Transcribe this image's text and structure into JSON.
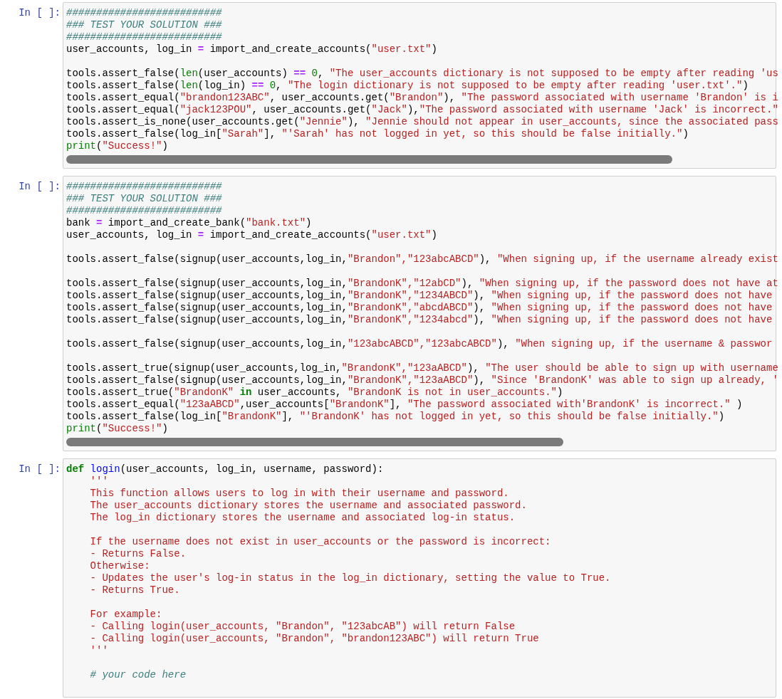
{
  "cells": [
    {
      "prompt": "In [ ]:",
      "lines": [
        {
          "kind": "code",
          "tokens": [
            {
              "kind": "comment",
              "text": "##########################"
            }
          ]
        },
        {
          "kind": "code",
          "tokens": [
            {
              "kind": "comment",
              "text": "### TEST YOUR SOLUTION ###"
            }
          ]
        },
        {
          "kind": "code",
          "tokens": [
            {
              "kind": "comment",
              "text": "##########################"
            }
          ]
        },
        {
          "kind": "code",
          "tokens": [
            {
              "kind": "plain",
              "text": "user_accounts, log_in "
            },
            {
              "kind": "op",
              "text": "="
            },
            {
              "kind": "plain",
              "text": " import_and_create_accounts("
            },
            {
              "kind": "str",
              "text": "\"user.txt\""
            },
            {
              "kind": "plain",
              "text": ")"
            }
          ]
        },
        {
          "kind": "blank"
        },
        {
          "kind": "code",
          "tokens": [
            {
              "kind": "plain",
              "text": "tools.assert_false("
            },
            {
              "kind": "builtin",
              "text": "len"
            },
            {
              "kind": "plain",
              "text": "(user_accounts) "
            },
            {
              "kind": "op",
              "text": "=="
            },
            {
              "kind": "num",
              "text": " 0"
            },
            {
              "kind": "plain",
              "text": ", "
            },
            {
              "kind": "str",
              "text": "\"The user_accounts dictionary is not supposed to be empty after reading 'us"
            }
          ]
        },
        {
          "kind": "code",
          "tokens": [
            {
              "kind": "plain",
              "text": "tools.assert_false("
            },
            {
              "kind": "builtin",
              "text": "len"
            },
            {
              "kind": "plain",
              "text": "(log_in) "
            },
            {
              "kind": "op",
              "text": "=="
            },
            {
              "kind": "num",
              "text": " 0"
            },
            {
              "kind": "plain",
              "text": ", "
            },
            {
              "kind": "str",
              "text": "\"The login dictionary is not supposed to be empty after reading 'user.txt'.\""
            },
            {
              "kind": "plain",
              "text": ")"
            }
          ]
        },
        {
          "kind": "code",
          "tokens": [
            {
              "kind": "plain",
              "text": "tools.assert_equal("
            },
            {
              "kind": "str",
              "text": "\"brandon123ABC\""
            },
            {
              "kind": "plain",
              "text": ", user_accounts.get("
            },
            {
              "kind": "str",
              "text": "\"Brandon\""
            },
            {
              "kind": "plain",
              "text": "), "
            },
            {
              "kind": "str",
              "text": "\"The password associated with username 'Brandon' is i"
            }
          ]
        },
        {
          "kind": "code",
          "tokens": [
            {
              "kind": "plain",
              "text": "tools.assert_equal("
            },
            {
              "kind": "str",
              "text": "\"jack123POU\""
            },
            {
              "kind": "plain",
              "text": ", user_accounts.get("
            },
            {
              "kind": "str",
              "text": "\"Jack\""
            },
            {
              "kind": "plain",
              "text": "),"
            },
            {
              "kind": "str",
              "text": "\"The password associated with username 'Jack' is incorrect.\""
            }
          ]
        },
        {
          "kind": "code",
          "tokens": [
            {
              "kind": "plain",
              "text": "tools.assert_is_none(user_accounts.get("
            },
            {
              "kind": "str",
              "text": "\"Jennie\""
            },
            {
              "kind": "plain",
              "text": "), "
            },
            {
              "kind": "str",
              "text": "\"Jennie should not appear in user_accounts, since the associated pass"
            }
          ]
        },
        {
          "kind": "code",
          "tokens": [
            {
              "kind": "plain",
              "text": "tools.assert_false(log_in["
            },
            {
              "kind": "str",
              "text": "\"Sarah\""
            },
            {
              "kind": "plain",
              "text": "], "
            },
            {
              "kind": "str",
              "text": "\"'Sarah' has not logged in yet, so this should be false initially.\""
            },
            {
              "kind": "plain",
              "text": ")"
            }
          ]
        },
        {
          "kind": "code",
          "tokens": [
            {
              "kind": "builtin",
              "text": "print"
            },
            {
              "kind": "plain",
              "text": "("
            },
            {
              "kind": "str",
              "text": "\"Success!\""
            },
            {
              "kind": "plain",
              "text": ")"
            }
          ]
        }
      ]
    },
    {
      "prompt": "In [ ]:",
      "lines": [
        {
          "kind": "code",
          "tokens": [
            {
              "kind": "comment",
              "text": "##########################"
            }
          ]
        },
        {
          "kind": "code",
          "tokens": [
            {
              "kind": "comment",
              "text": "### TEST YOUR SOLUTION ###"
            }
          ]
        },
        {
          "kind": "code",
          "tokens": [
            {
              "kind": "comment",
              "text": "##########################"
            }
          ]
        },
        {
          "kind": "code",
          "tokens": [
            {
              "kind": "plain",
              "text": "bank "
            },
            {
              "kind": "op",
              "text": "="
            },
            {
              "kind": "plain",
              "text": " import_and_create_bank("
            },
            {
              "kind": "str",
              "text": "\"bank.txt\""
            },
            {
              "kind": "plain",
              "text": ")"
            }
          ]
        },
        {
          "kind": "code",
          "tokens": [
            {
              "kind": "plain",
              "text": "user_accounts, log_in "
            },
            {
              "kind": "op",
              "text": "="
            },
            {
              "kind": "plain",
              "text": " import_and_create_accounts("
            },
            {
              "kind": "str",
              "text": "\"user.txt\""
            },
            {
              "kind": "plain",
              "text": ")"
            }
          ]
        },
        {
          "kind": "blank"
        },
        {
          "kind": "code",
          "tokens": [
            {
              "kind": "plain",
              "text": "tools.assert_false(signup(user_accounts,log_in,"
            },
            {
              "kind": "str",
              "text": "\"Brandon\",\"123abcABCD\""
            },
            {
              "kind": "plain",
              "text": "), "
            },
            {
              "kind": "str",
              "text": "\"When signing up, if the username already exist"
            }
          ]
        },
        {
          "kind": "blank"
        },
        {
          "kind": "code",
          "tokens": [
            {
              "kind": "plain",
              "text": "tools.assert_false(signup(user_accounts,log_in,"
            },
            {
              "kind": "str",
              "text": "\"BrandonK\",\"12abCD\""
            },
            {
              "kind": "plain",
              "text": "), "
            },
            {
              "kind": "str",
              "text": "\"When signing up, if the password does not have at"
            }
          ]
        },
        {
          "kind": "code",
          "tokens": [
            {
              "kind": "plain",
              "text": "tools.assert_false(signup(user_accounts,log_in,"
            },
            {
              "kind": "str",
              "text": "\"BrandonK\",\"1234ABCD\""
            },
            {
              "kind": "plain",
              "text": "), "
            },
            {
              "kind": "str",
              "text": "\"When signing up, if the password does not have"
            }
          ]
        },
        {
          "kind": "code",
          "tokens": [
            {
              "kind": "plain",
              "text": "tools.assert_false(signup(user_accounts,log_in,"
            },
            {
              "kind": "str",
              "text": "\"BrandonK\",\"abcdABCD\""
            },
            {
              "kind": "plain",
              "text": "), "
            },
            {
              "kind": "str",
              "text": "\"When signing up, if the password does not have"
            }
          ]
        },
        {
          "kind": "code",
          "tokens": [
            {
              "kind": "plain",
              "text": "tools.assert_false(signup(user_accounts,log_in,"
            },
            {
              "kind": "str",
              "text": "\"BrandonK\",\"1234abcd\""
            },
            {
              "kind": "plain",
              "text": "), "
            },
            {
              "kind": "str",
              "text": "\"When signing up, if the password does not have"
            }
          ]
        },
        {
          "kind": "blank"
        },
        {
          "kind": "code",
          "tokens": [
            {
              "kind": "plain",
              "text": "tools.assert_false(signup(user_accounts,log_in,"
            },
            {
              "kind": "str",
              "text": "\"123abcABCD\",\"123abcABCD\""
            },
            {
              "kind": "plain",
              "text": "), "
            },
            {
              "kind": "str",
              "text": "\"When signing up, if the username & passwor"
            }
          ]
        },
        {
          "kind": "blank"
        },
        {
          "kind": "code",
          "tokens": [
            {
              "kind": "plain",
              "text": "tools.assert_true(signup(user_accounts,log_in,"
            },
            {
              "kind": "str",
              "text": "\"BrandonK\",\"123aABCD\""
            },
            {
              "kind": "plain",
              "text": "), "
            },
            {
              "kind": "str",
              "text": "\"The user should be able to sign up with username"
            }
          ]
        },
        {
          "kind": "code",
          "tokens": [
            {
              "kind": "plain",
              "text": "tools.assert_false(signup(user_accounts,log_in,"
            },
            {
              "kind": "str",
              "text": "\"BrandonK\",\"123aABCD\""
            },
            {
              "kind": "plain",
              "text": "), "
            },
            {
              "kind": "str",
              "text": "\"Since 'BrandonK' was able to sign up already, '"
            }
          ]
        },
        {
          "kind": "code",
          "tokens": [
            {
              "kind": "plain",
              "text": "tools.assert_true("
            },
            {
              "kind": "str",
              "text": "\"BrandonK\""
            },
            {
              "kind": "keyword",
              "text": " in"
            },
            {
              "kind": "plain",
              "text": " user_accounts, "
            },
            {
              "kind": "str",
              "text": "\"BrandonK is not in user_accounts.\""
            },
            {
              "kind": "plain",
              "text": ")"
            }
          ]
        },
        {
          "kind": "code",
          "tokens": [
            {
              "kind": "plain",
              "text": "tools.assert_equal("
            },
            {
              "kind": "str",
              "text": "\"123aABCD\""
            },
            {
              "kind": "plain",
              "text": ",user_accounts["
            },
            {
              "kind": "str",
              "text": "\"BrandonK\""
            },
            {
              "kind": "plain",
              "text": "], "
            },
            {
              "kind": "str",
              "text": "\"The password associated with'BrandonK' is incorrect.\""
            },
            {
              "kind": "plain",
              "text": " )"
            }
          ]
        },
        {
          "kind": "code",
          "tokens": [
            {
              "kind": "plain",
              "text": "tools.assert_false(log_in["
            },
            {
              "kind": "str",
              "text": "\"BrandonK\""
            },
            {
              "kind": "plain",
              "text": "], "
            },
            {
              "kind": "str",
              "text": "\"'BrandonK' has not logged in yet, so this should be false initially.\""
            },
            {
              "kind": "plain",
              "text": ")"
            }
          ]
        },
        {
          "kind": "code",
          "tokens": [
            {
              "kind": "builtin",
              "text": "print"
            },
            {
              "kind": "plain",
              "text": "("
            },
            {
              "kind": "str",
              "text": "\"Success!\""
            },
            {
              "kind": "plain",
              "text": ")"
            }
          ]
        }
      ]
    },
    {
      "prompt": "In [ ]:",
      "lines": [
        {
          "kind": "code",
          "tokens": [
            {
              "kind": "keyword",
              "text": "def"
            },
            {
              "kind": "defname",
              "text": " login"
            },
            {
              "kind": "plain",
              "text": "(user_accounts, log_in, username, password):"
            }
          ]
        },
        {
          "kind": "code",
          "tokens": [
            {
              "kind": "str",
              "text": "    '''"
            }
          ]
        },
        {
          "kind": "code",
          "tokens": [
            {
              "kind": "str",
              "text": "    This function allows users to log in with their username and password."
            }
          ]
        },
        {
          "kind": "code",
          "tokens": [
            {
              "kind": "str",
              "text": "    The user_accounts dictionary stores the username and associated password."
            }
          ]
        },
        {
          "kind": "code",
          "tokens": [
            {
              "kind": "str",
              "text": "    The log_in dictionary stores the username and associated log-in status."
            }
          ]
        },
        {
          "kind": "blank"
        },
        {
          "kind": "code",
          "tokens": [
            {
              "kind": "str",
              "text": "    If the username does not exist in user_accounts or the password is incorrect:"
            }
          ]
        },
        {
          "kind": "code",
          "tokens": [
            {
              "kind": "str",
              "text": "    - Returns False."
            }
          ]
        },
        {
          "kind": "code",
          "tokens": [
            {
              "kind": "str",
              "text": "    Otherwise:"
            }
          ]
        },
        {
          "kind": "code",
          "tokens": [
            {
              "kind": "str",
              "text": "    - Updates the user's log-in status in the log_in dictionary, setting the value to True."
            }
          ]
        },
        {
          "kind": "code",
          "tokens": [
            {
              "kind": "str",
              "text": "    - Returns True."
            }
          ]
        },
        {
          "kind": "blank"
        },
        {
          "kind": "code",
          "tokens": [
            {
              "kind": "str",
              "text": "    For example:"
            }
          ]
        },
        {
          "kind": "code",
          "tokens": [
            {
              "kind": "str",
              "text": "    - Calling login(user_accounts, \"Brandon\", \"123abcAB\") will return False"
            }
          ]
        },
        {
          "kind": "code",
          "tokens": [
            {
              "kind": "str",
              "text": "    - Calling login(user_accounts, \"Brandon\", \"brandon123ABC\") will return True"
            }
          ]
        },
        {
          "kind": "code",
          "tokens": [
            {
              "kind": "str",
              "text": "    '''"
            }
          ]
        },
        {
          "kind": "blank"
        },
        {
          "kind": "code",
          "tokens": [
            {
              "kind": "comment",
              "text": "    # your code here"
            }
          ]
        },
        {
          "kind": "blank"
        }
      ]
    }
  ]
}
